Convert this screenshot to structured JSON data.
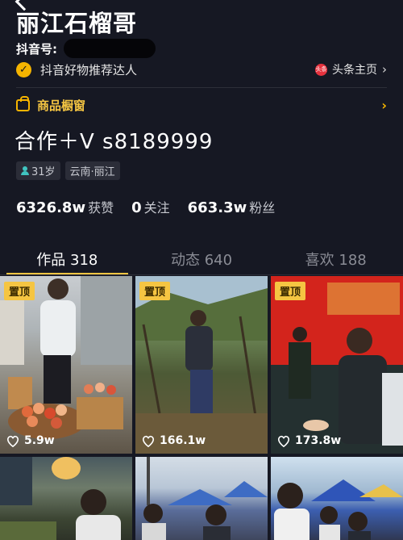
{
  "profile": {
    "name": "丽江石榴哥",
    "id_label": "抖音号:",
    "cert_text": "抖音好物推荐达人",
    "toutiao_label": "头条主页",
    "toutiao_badge": "头条",
    "shop_label": "商品橱窗",
    "bio": "合作＋V   s8189999",
    "tags": [
      "31岁",
      "云南·丽江"
    ],
    "stats": [
      {
        "num": "6326.8w",
        "label": "获赞"
      },
      {
        "num": "0",
        "label": "关注"
      },
      {
        "num": "663.3w",
        "label": "粉丝"
      }
    ]
  },
  "tabs": [
    "作品 318",
    "动态 640",
    "喜欢 188"
  ],
  "videos": [
    {
      "pinned": "置顶",
      "likes": "5.9w",
      "scene": "man-with-pomegranates"
    },
    {
      "pinned": "置顶",
      "likes": "166.1w",
      "scene": "man-in-field"
    },
    {
      "pinned": "置顶",
      "likes": "173.8w",
      "scene": "handshake-at-event"
    },
    {
      "pinned": "",
      "likes": "",
      "scene": "night-market"
    },
    {
      "pinned": "",
      "likes": "",
      "scene": "outdoor-tents"
    },
    {
      "pinned": "",
      "likes": "",
      "scene": "crowd-blue-tents"
    }
  ],
  "colors": {
    "background": "#161823",
    "accent": "#f5c542",
    "muted": "#8a8c95"
  }
}
